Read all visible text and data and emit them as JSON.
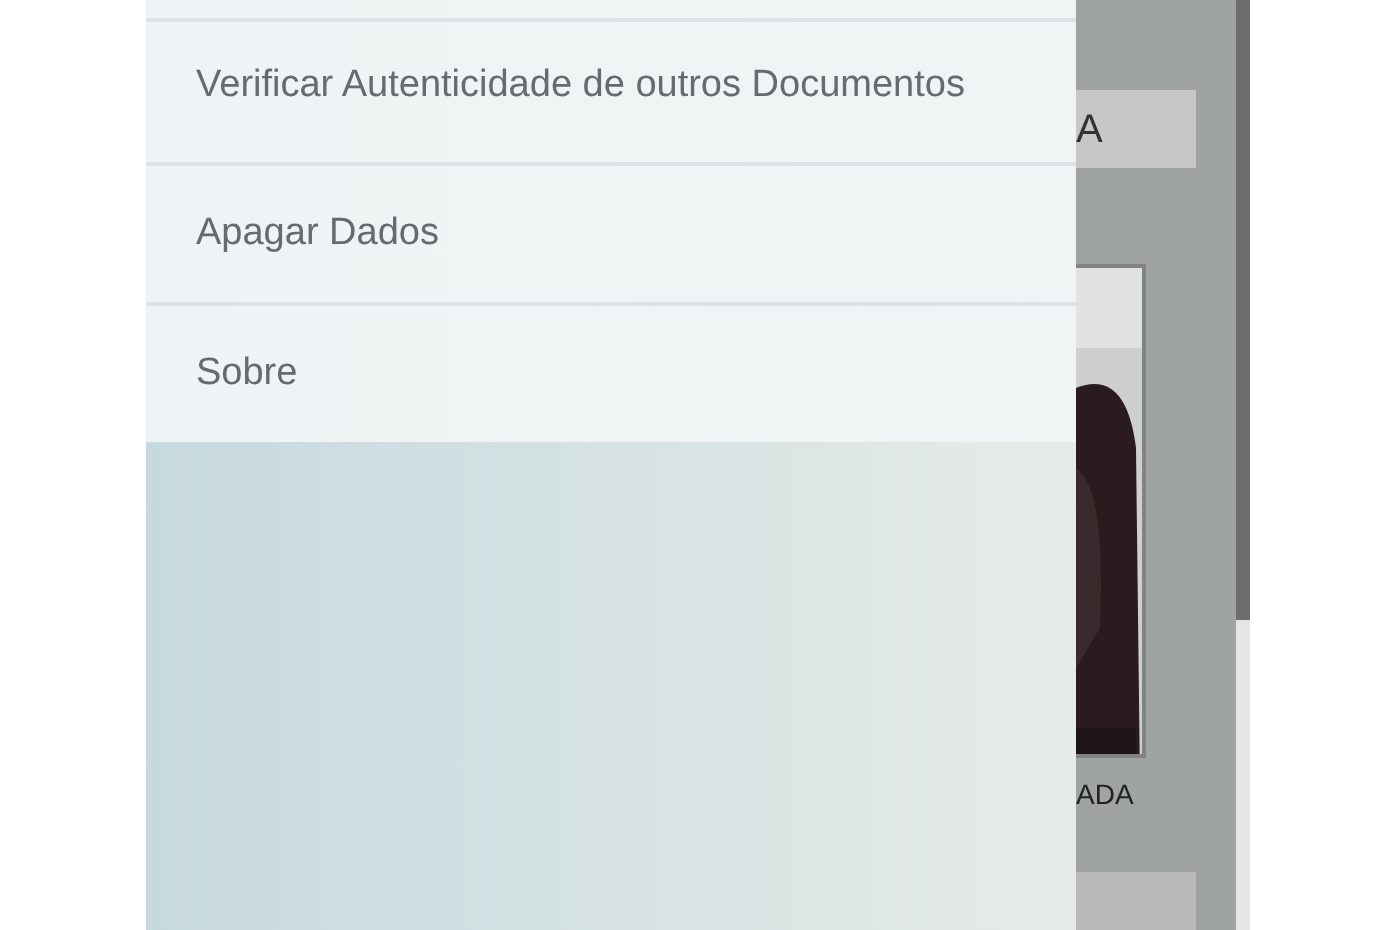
{
  "drawer": {
    "items": [
      {
        "label": "Verificar Autenticidade de outros Documentos"
      },
      {
        "label": "Apagar Dados"
      },
      {
        "label": "Sobre"
      }
    ]
  },
  "background": {
    "field_text": "A",
    "caption": "ADA"
  }
}
